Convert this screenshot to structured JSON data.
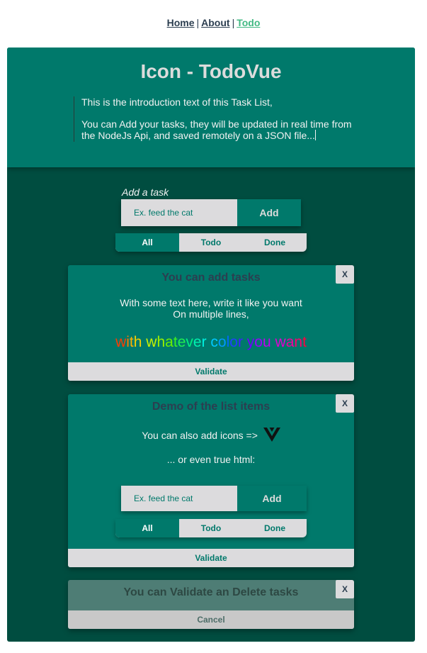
{
  "nav": {
    "home": "Home",
    "about": "About",
    "todo": "Todo",
    "separator": "|"
  },
  "header": {
    "title": "Icon - TodoVue",
    "intro_line1": "This is the introduction text of this Task List,",
    "intro_line2": "You can Add your tasks, they will be updated in real time from the NodeJs Api, and saved remotely on a JSON file..."
  },
  "add_task": {
    "label": "Add a task",
    "placeholder": "Ex. feed the cat",
    "button": "Add"
  },
  "filters": {
    "all": "All",
    "todo": "Todo",
    "done": "Done",
    "selected": "All"
  },
  "tasks": [
    {
      "title": "You can add tasks",
      "close": "X",
      "line1": "With some text here, write it like you want",
      "line2": "On multiple lines,",
      "rainbow": [
        {
          "text": "w",
          "color": "#ff3b00"
        },
        {
          "text": "i",
          "color": "#ff7a00"
        },
        {
          "text": "t",
          "color": "#ffb000"
        },
        {
          "text": "h",
          "color": "#f5d000"
        },
        {
          "text": " ",
          "color": "#ffffff"
        },
        {
          "text": "w",
          "color": "#c8f000"
        },
        {
          "text": "h",
          "color": "#9cf000"
        },
        {
          "text": "a",
          "color": "#6cf000"
        },
        {
          "text": "t",
          "color": "#3cf020"
        },
        {
          "text": "e",
          "color": "#20f050"
        },
        {
          "text": "v",
          "color": "#00f080"
        },
        {
          "text": "e",
          "color": "#00f0b0"
        },
        {
          "text": "r",
          "color": "#00f0e0"
        },
        {
          "text": " ",
          "color": "#ffffff"
        },
        {
          "text": "c",
          "color": "#00c8ff"
        },
        {
          "text": "o",
          "color": "#0098ff"
        },
        {
          "text": "l",
          "color": "#0068ff"
        },
        {
          "text": "o",
          "color": "#2040ff"
        },
        {
          "text": "r",
          "color": "#4020ff"
        },
        {
          "text": " ",
          "color": "#ffffff"
        },
        {
          "text": "y",
          "color": "#7000ff"
        },
        {
          "text": "o",
          "color": "#9a00ff"
        },
        {
          "text": "u",
          "color": "#c000f0"
        },
        {
          "text": " ",
          "color": "#ffffff"
        },
        {
          "text": "w",
          "color": "#e000d0"
        },
        {
          "text": "a",
          "color": "#f000a0"
        },
        {
          "text": "n",
          "color": "#ff0070"
        },
        {
          "text": "t",
          "color": "#ff0040"
        }
      ],
      "action": "Validate"
    },
    {
      "title": "Demo of the list items",
      "close": "X",
      "line1": "You can also add icons =>",
      "line2": "... or even true html:",
      "icon": "vue-logo-icon",
      "embedded_placeholder": "Ex. feed the cat",
      "embedded_button": "Add",
      "embedded_filters": [
        "All",
        "Todo",
        "Done"
      ],
      "action": "Validate"
    },
    {
      "title": "You can Validate an Delete tasks",
      "close": "X",
      "action": "Cancel",
      "state": "done"
    }
  ],
  "colors": {
    "primary": "#00796b",
    "dark": "#004d40",
    "light": "#dcdbdd",
    "nav_active": "#42b983",
    "text_dark": "#2c3e50"
  }
}
